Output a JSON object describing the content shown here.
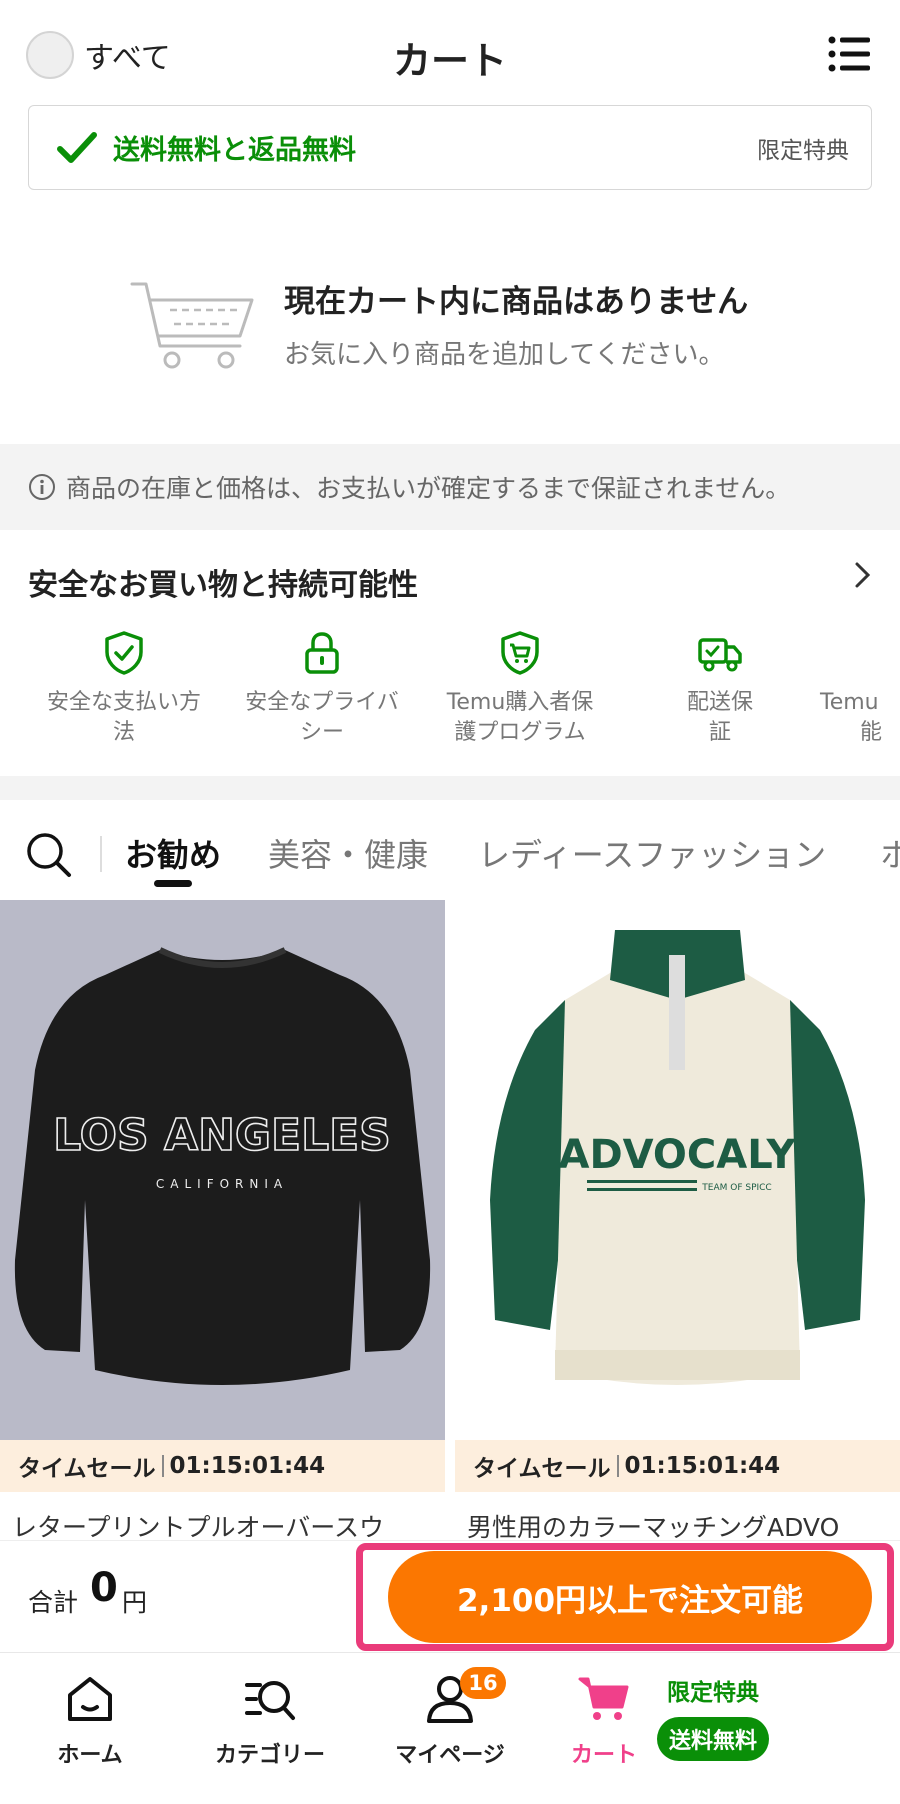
{
  "header": {
    "select_all_label": "すべて",
    "title": "カート"
  },
  "shipping_banner": {
    "text": "送料無料と返品無料",
    "right_label": "限定特典"
  },
  "empty_cart": {
    "title": "現在カート内に商品はありません",
    "subtitle": "お気に入り商品を追加してください。"
  },
  "notice": {
    "text": "商品の在庫と価格は、お支払いが確定するまで保証されません。"
  },
  "safety": {
    "title": "安全なお買い物と持続可能性",
    "items": [
      {
        "line1": "安全な支払い方",
        "line2": "法",
        "icon": "shield-check-icon"
      },
      {
        "line1": "安全なプライバ",
        "line2": "シー",
        "icon": "lock-icon"
      },
      {
        "line1": "Temu購入者保",
        "line2": "護プログラム",
        "icon": "shield-cart-icon"
      },
      {
        "line1": "配送保",
        "line2": "証",
        "icon": "truck-check-icon"
      },
      {
        "line1": "Temu",
        "line2": "能",
        "icon": "leaf-icon"
      }
    ]
  },
  "tabs": {
    "items": [
      "お勧め",
      "美容・健康",
      "レディースファッション",
      "ホ"
    ],
    "active_index": 0
  },
  "products": [
    {
      "sale_label": "タイムセール",
      "timer": "01:15:01:44",
      "name": "レタープリントプルオーバースウ",
      "image_print": "LOS ANGELES",
      "image_subprint": "CALIFORNIA"
    },
    {
      "sale_label": "タイムセール",
      "timer": "01:15:01:44",
      "name": "男性用のカラーマッチングADVO",
      "image_print": "ADVOCALY",
      "image_subprint": "TEAM OF SPICC"
    }
  ],
  "checkout": {
    "total_label": "合計",
    "total_value": "0",
    "total_unit": "円",
    "button_label": "2,100円以上で注文可能"
  },
  "bottom_nav": {
    "items": [
      {
        "label": "ホーム",
        "icon": "home-icon"
      },
      {
        "label": "カテゴリー",
        "icon": "category-search-icon"
      },
      {
        "label": "マイページ",
        "icon": "user-icon",
        "badge": "16"
      },
      {
        "label": "カート",
        "icon": "cart-icon",
        "active": true
      }
    ],
    "promo_text": "限定特典",
    "promo_badge": "送料無料"
  },
  "colors": {
    "accent_orange": "#fb7701",
    "green": "#0a8f08",
    "cart_pink": "#f0408a",
    "highlight_border": "#ea3b7a"
  }
}
